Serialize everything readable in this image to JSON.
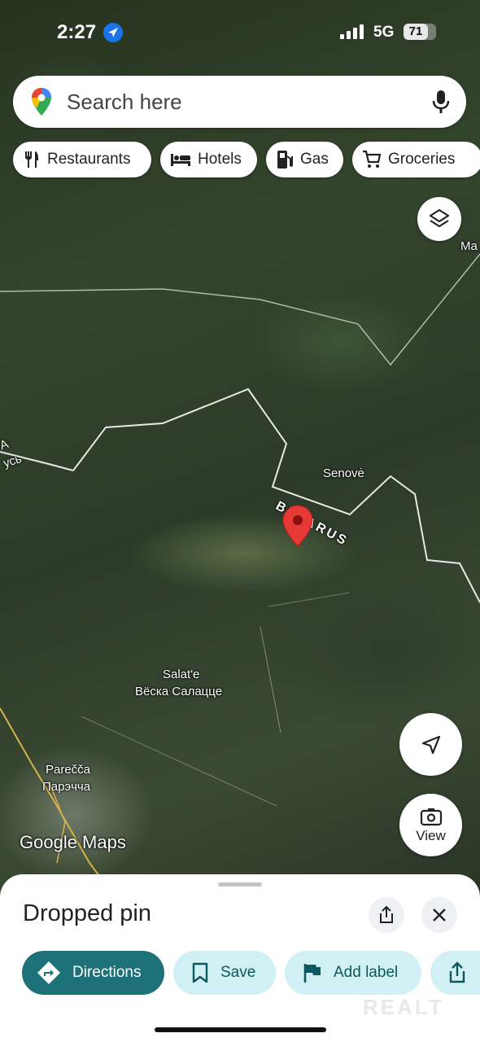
{
  "status_bar": {
    "time": "2:27",
    "network": "5G",
    "battery": "71"
  },
  "search": {
    "placeholder": "Search here"
  },
  "chips": [
    {
      "label": "Restaurants",
      "icon": "fork-knife-icon"
    },
    {
      "label": "Hotels",
      "icon": "bed-icon"
    },
    {
      "label": "Gas",
      "icon": "gas-pump-icon"
    },
    {
      "label": "Groceries",
      "icon": "cart-icon"
    }
  ],
  "map": {
    "labels": {
      "senove": "Senovė",
      "belarus": "BELARUS",
      "salate_latin": "Salat'e",
      "salate_cyrillic": "Вёска Салацце",
      "parecca_latin": "Parečča",
      "parecca_cyrillic": "Парэчча",
      "ma_partial": "Ma",
      "usy_partial": "усь",
      "a_partial": "A",
      "brand": "Google Maps"
    }
  },
  "buttons": {
    "view": "View"
  },
  "sheet": {
    "title": "Dropped pin",
    "actions": [
      {
        "label": "Directions",
        "icon": "directions-icon"
      },
      {
        "label": "Save",
        "icon": "bookmark-icon"
      },
      {
        "label": "Add label",
        "icon": "flag-icon"
      }
    ]
  },
  "watermark": "REALT",
  "colors": {
    "accent": "#1d7179",
    "accent_light": "#d1f0f3",
    "pin": "#e53935",
    "location_blue": "#1a73e8"
  }
}
